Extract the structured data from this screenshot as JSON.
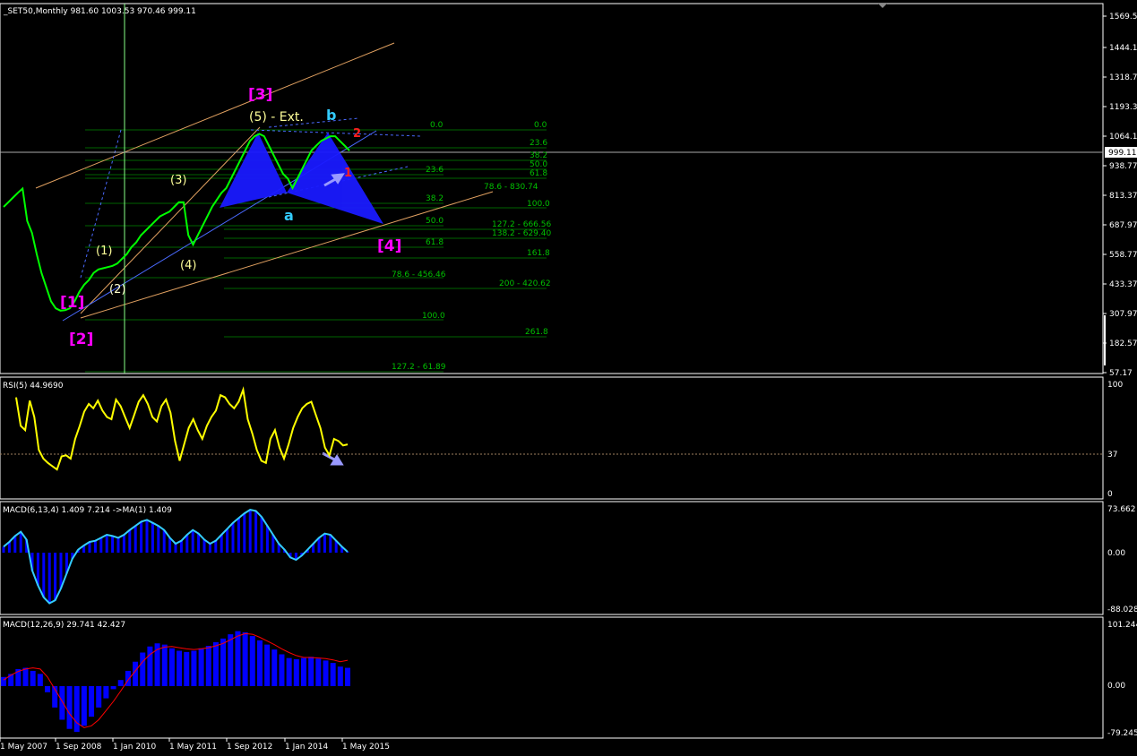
{
  "window": {
    "symbol_title": "_SET50,Monthly  981.60 1003.53 970.46 999.11",
    "current_price_label": "999.11"
  },
  "colors": {
    "background": "#000000",
    "grid_frame": "#ffffff",
    "bull_candle": "#00ff00",
    "fib_line": "#006400",
    "fib_text": "#00c000",
    "channel": "#e0a060",
    "pattern_fill": "#1a1aff",
    "wave_magenta": "#ff00ff",
    "wave_yellow": "#ffff99",
    "wave_cyan": "#33ccff",
    "rsi_line": "#ffff00",
    "macd_line": "#33ccff",
    "macd_hist": "#0000ff",
    "signal_line": "#ff0000",
    "arrow": "#9999ff"
  },
  "main_axis": {
    "ticks": [
      "1569.57",
      "1444.17",
      "1318.77",
      "1193.37",
      "1064.17",
      "938.77",
      "813.37",
      "687.97",
      "558.77",
      "433.37",
      "307.97",
      "182.57",
      "57.17"
    ]
  },
  "wave_labels": {
    "w1_bracket": "[1]",
    "w2_bracket": "[2]",
    "w3_bracket": "[3]",
    "w4_bracket": "[4]",
    "sub1": "(1)",
    "sub2": "(2)",
    "sub3": "(3)",
    "sub4": "(4)",
    "sub5_ext": "(5) - Ext.",
    "a": "a",
    "b": "b",
    "pt1": "1",
    "pt2": "2"
  },
  "fib_labels": {
    "l0a": "0.0",
    "l0b": "0.0",
    "l236a": "23.6",
    "l382a": "38.2",
    "l500a": "50.0",
    "l618a": "61.8",
    "l236b": "23.6",
    "l786_830": "78.6 - 830.74",
    "l1000a": "100.0",
    "l382b": "38.2",
    "l500b": "50.0",
    "l1272_666": "127.2 - 666.56",
    "l1382_629": "138.2 - 629.40",
    "l618b": "61.8",
    "l1618": "161.8",
    "l786_456": "78.6 - 456.46",
    "l200_420": "200 - 420.62",
    "l1000b": "100.0",
    "l2618": "261.8",
    "l1272_61": "127.2 - 61.89"
  },
  "rsi_panel": {
    "title": "RSI(5) 44.9690",
    "ticks": [
      "100",
      "37",
      "0"
    ]
  },
  "macd1_panel": {
    "title": "MACD(6,13,4) 1.409 7.214  ->MA(1) 1.409",
    "ticks": [
      "73.662",
      "0.00",
      "-88.028"
    ]
  },
  "macd2_panel": {
    "title": "MACD(12,26,9) 29.741 42.427",
    "ticks": [
      "101.244",
      "0.00",
      "-79.245"
    ]
  },
  "time_axis": {
    "labels": [
      "1 May 2007",
      "1 Sep 2008",
      "1 Jan 2010",
      "1 May 2011",
      "1 Sep 2012",
      "1 Jan 2014",
      "1 May 2015"
    ]
  },
  "chart_data": {
    "type": "line",
    "price_closes": [
      760,
      780,
      800,
      820,
      838,
      700,
      650,
      560,
      480,
      420,
      360,
      330,
      320,
      322,
      330,
      360,
      400,
      430,
      450,
      480,
      495,
      500,
      505,
      510,
      520,
      540,
      560,
      590,
      610,
      640,
      660,
      680,
      700,
      720,
      730,
      740,
      760,
      780,
      780,
      640,
      600,
      640,
      680,
      720,
      760,
      790,
      820,
      840,
      880,
      920,
      960,
      1000,
      1040,
      1060,
      1070,
      1060,
      1020,
      980,
      940,
      900,
      880,
      840,
      880,
      920,
      960,
      1000,
      1020,
      1040,
      1050,
      1060,
      1060,
      1040,
      1020,
      999
    ],
    "rsi": [
      88,
      62,
      58,
      85,
      70,
      40,
      32,
      28,
      25,
      22,
      34,
      35,
      32,
      50,
      62,
      75,
      82,
      78,
      85,
      76,
      70,
      68,
      86,
      80,
      70,
      60,
      72,
      84,
      90,
      82,
      70,
      66,
      80,
      86,
      74,
      48,
      30,
      45,
      60,
      68,
      58,
      50,
      62,
      70,
      76,
      90,
      88,
      82,
      78,
      84,
      95,
      68,
      55,
      40,
      30,
      28,
      50,
      58,
      42,
      32,
      45,
      60,
      70,
      78,
      82,
      84,
      72,
      60,
      42,
      35,
      50,
      48,
      44,
      45
    ],
    "macd_fast": [
      10,
      18,
      28,
      35,
      22,
      -30,
      -55,
      -75,
      -85,
      -80,
      -60,
      -35,
      -10,
      5,
      12,
      18,
      20,
      25,
      30,
      28,
      25,
      30,
      38,
      45,
      52,
      55,
      50,
      45,
      38,
      25,
      15,
      20,
      30,
      38,
      32,
      22,
      15,
      20,
      30,
      40,
      50,
      58,
      66,
      72,
      70,
      60,
      45,
      30,
      15,
      5,
      -8,
      -12,
      -5,
      5,
      15,
      25,
      32,
      30,
      20,
      10,
      1.409
    ],
    "macd_slow_hist": [
      15,
      20,
      28,
      30,
      25,
      20,
      -10,
      -35,
      -55,
      -70,
      -75,
      -65,
      -50,
      -35,
      -20,
      -5,
      10,
      25,
      40,
      55,
      65,
      70,
      68,
      62,
      58,
      56,
      58,
      62,
      66,
      72,
      78,
      85,
      90,
      88,
      82,
      75,
      68,
      60,
      52,
      46,
      44,
      46,
      48,
      45,
      42,
      38,
      32,
      30
    ],
    "macd_signal": [
      10,
      18,
      24,
      28,
      30,
      28,
      15,
      -5,
      -25,
      -45,
      -60,
      -68,
      -65,
      -55,
      -40,
      -25,
      -8,
      10,
      25,
      40,
      52,
      60,
      64,
      65,
      63,
      61,
      60,
      61,
      63,
      66,
      70,
      76,
      82,
      86,
      85,
      80,
      74,
      68,
      61,
      55,
      50,
      47,
      47,
      46,
      45,
      43,
      40,
      42.427
    ]
  }
}
